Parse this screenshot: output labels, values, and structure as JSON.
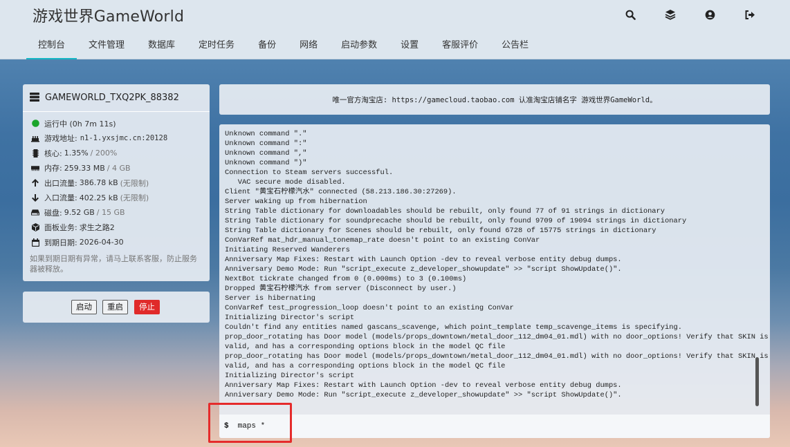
{
  "header": {
    "brand": "游戏世界GameWorld",
    "icons": [
      "search-icon",
      "layers-icon",
      "user-icon",
      "logout-icon"
    ]
  },
  "nav": {
    "items": [
      {
        "label": "控制台",
        "active": true
      },
      {
        "label": "文件管理"
      },
      {
        "label": "数据库"
      },
      {
        "label": "定时任务"
      },
      {
        "label": "备份"
      },
      {
        "label": "网络"
      },
      {
        "label": "启动参数"
      },
      {
        "label": "设置"
      },
      {
        "label": "客服评价"
      },
      {
        "label": "公告栏"
      }
    ]
  },
  "server": {
    "name": "GAMEWORLD_TXQ2PK_88382",
    "status": "运行中 (0h 7m 11s)",
    "status_color": "#1aa52b",
    "address_label": "游戏地址:",
    "address": "n1-1.yxsjmc.cn:20128",
    "cpu_label": "核心:",
    "cpu": "1.35%",
    "cpu_max": "/ 200%",
    "mem_label": "内存:",
    "mem": "259.33 MB",
    "mem_max": "/ 4 GB",
    "out_label": "出口流量:",
    "out": "386.78 kB",
    "out_limit": "(无限制)",
    "in_label": "入口流量:",
    "in": "402.25 kB",
    "in_limit": "(无限制)",
    "disk_label": "磁盘:",
    "disk": "9.52 GB",
    "disk_max": "/ 15 GB",
    "panel_label": "面板业务:",
    "panel": "求生之路2",
    "expire_label": "到期日期:",
    "expire": "2026-04-30",
    "notice": "如果到期日期有异常，请马上联系客服，防止服务器被释放。"
  },
  "controls": {
    "start": "启动",
    "restart": "重启",
    "stop": "停止",
    "stop_color": "#e02a2a"
  },
  "ad": {
    "text": "唯一官方淘宝店: https://gamecloud.taobao.com 认准淘宝店铺名字 游戏世界GameWorld。"
  },
  "console": {
    "lines": [
      "Unknown command \".\"",
      "Unknown command \":\"",
      "Unknown command \",\"",
      "Unknown command \")\"",
      "Connection to Steam servers successful.",
      "   VAC secure mode disabled.",
      "Client \"黄宝石柠檬汽水\" connected (58.213.186.30:27269).",
      "Server waking up from hibernation",
      "String Table dictionary for downloadables should be rebuilt, only found 77 of 91 strings in dictionary",
      "String Table dictionary for soundprecache should be rebuilt, only found 9709 of 19094 strings in dictionary",
      "String Table dictionary for Scenes should be rebuilt, only found 6728 of 15775 strings in dictionary",
      "ConVarRef mat_hdr_manual_tonemap_rate doesn't point to an existing ConVar",
      "Initiating Reserved Wanderers",
      "Anniversary Map Fixes: Restart with Launch Option -dev to reveal verbose entity debug dumps.",
      "Anniversary Demo Mode: Run \"script_execute z_developer_showupdate\" >> \"script ShowUpdate()\".",
      "NextBot tickrate changed from 0 (0.000ms) to 3 (0.100ms)",
      "Dropped 黄宝石柠檬汽水 from server (Disconnect by user.)",
      "Server is hibernating",
      "ConVarRef test_progression_loop doesn't point to an existing ConVar",
      "Initializing Director's script",
      "Couldn't find any entities named gascans_scavenge, which point_template temp_scavenge_items is specifying.",
      "prop_door_rotating has Door model (models/props_downtown/metal_door_112_dm04_01.mdl) with no door_options! Verify that SKIN is",
      "valid, and has a corresponding options block in the model QC file",
      "prop_door_rotating has Door model (models/props_downtown/metal_door_112_dm04_01.mdl) with no door_options! Verify that SKIN is",
      "valid, and has a corresponding options block in the model QC file",
      "Initializing Director's script",
      "Anniversary Map Fixes: Restart with Launch Option -dev to reveal verbose entity debug dumps.",
      "Anniversary Demo Mode: Run \"script_execute z_developer_showupdate\" >> \"script ShowUpdate()\"."
    ],
    "prompt": "$",
    "command_value": "maps *"
  }
}
